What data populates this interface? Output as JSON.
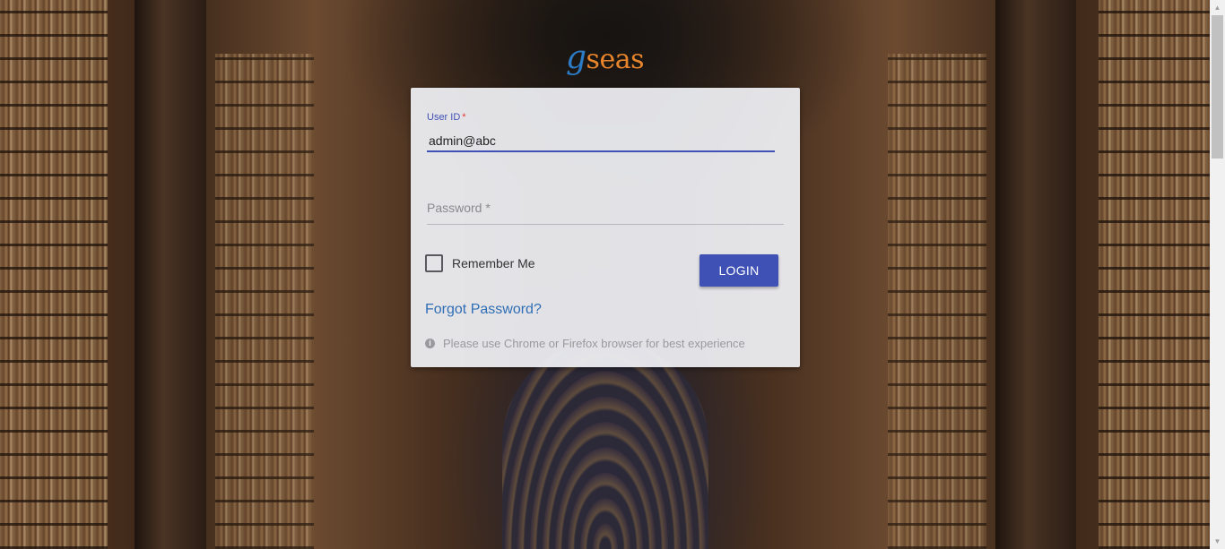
{
  "logo": {
    "g": "g",
    "rest": "seas"
  },
  "login_form": {
    "userid_label": "User ID",
    "userid_required": "*",
    "userid_value": "admin@abc",
    "password_label": "Password *",
    "remember_label": "Remember Me",
    "remember_checked": false,
    "login_button": "LOGIN",
    "forgot_link": "Forgot Password?",
    "browser_notice": "Please use Chrome or Firefox browser for best experience"
  },
  "colors": {
    "primary": "#3f51b5",
    "link": "#2f6eb5",
    "logo_g": "#2c7bc4",
    "logo_text": "#e8852c"
  },
  "icons": {
    "notice": "info-icon",
    "scroll_up": "scroll-up-arrow-icon",
    "scroll_down": "scroll-down-arrow-icon"
  }
}
